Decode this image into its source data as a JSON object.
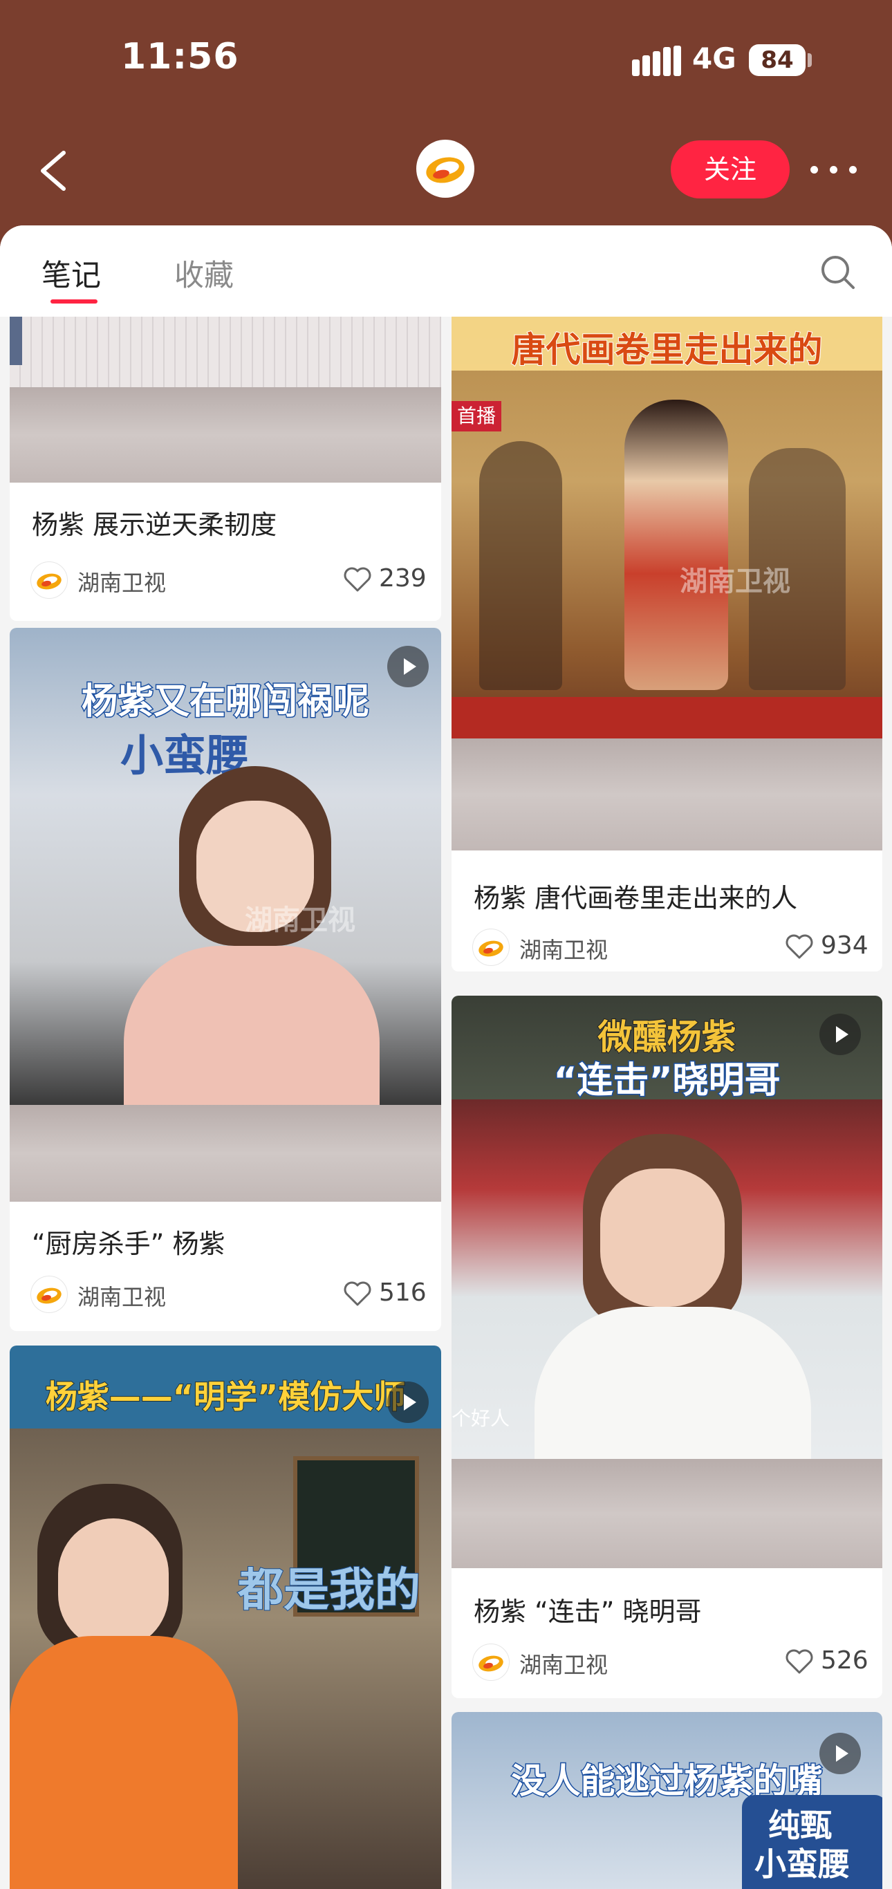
{
  "status_bar": {
    "time": "11:56",
    "network": "4G",
    "battery": "84"
  },
  "header": {
    "follow_label": "关注"
  },
  "tabs": [
    {
      "label": "笔记",
      "active": true
    },
    {
      "label": "收藏",
      "active": false
    }
  ],
  "colors": {
    "header_bg": "#7a3e2e",
    "accent": "#ff2442"
  },
  "cards": [
    {
      "title": "杨紫 展示逆天柔韧度",
      "author": "湖南卫视",
      "likes": "239"
    },
    {
      "title": "杨紫 唐代画卷里走出来的人",
      "author": "湖南卫视",
      "likes": "934",
      "banner": "唐代画卷里走出来的",
      "overlay": "首播",
      "watermark": "湖南卫视"
    },
    {
      "title": "“厨房杀手” 杨紫",
      "author": "湖南卫视",
      "likes": "516",
      "banner": "杨紫又在哪闯祸呢",
      "overlay": "小蛮腰",
      "watermark": "湖南卫视"
    },
    {
      "title": "杨紫 “连击” 晓明哥",
      "author": "湖南卫视",
      "likes": "526",
      "banner_line1": "微醺杨紫",
      "banner_line2": "“连击”晓明哥",
      "overlay": "个好人"
    },
    {
      "banner": "杨紫——“明学”模仿大师",
      "overlay": "都是我的"
    },
    {
      "banner": "没人能逃过杨紫的嘴",
      "overlay_line1": "纯甄",
      "overlay_line2": "小蛮腰"
    }
  ]
}
